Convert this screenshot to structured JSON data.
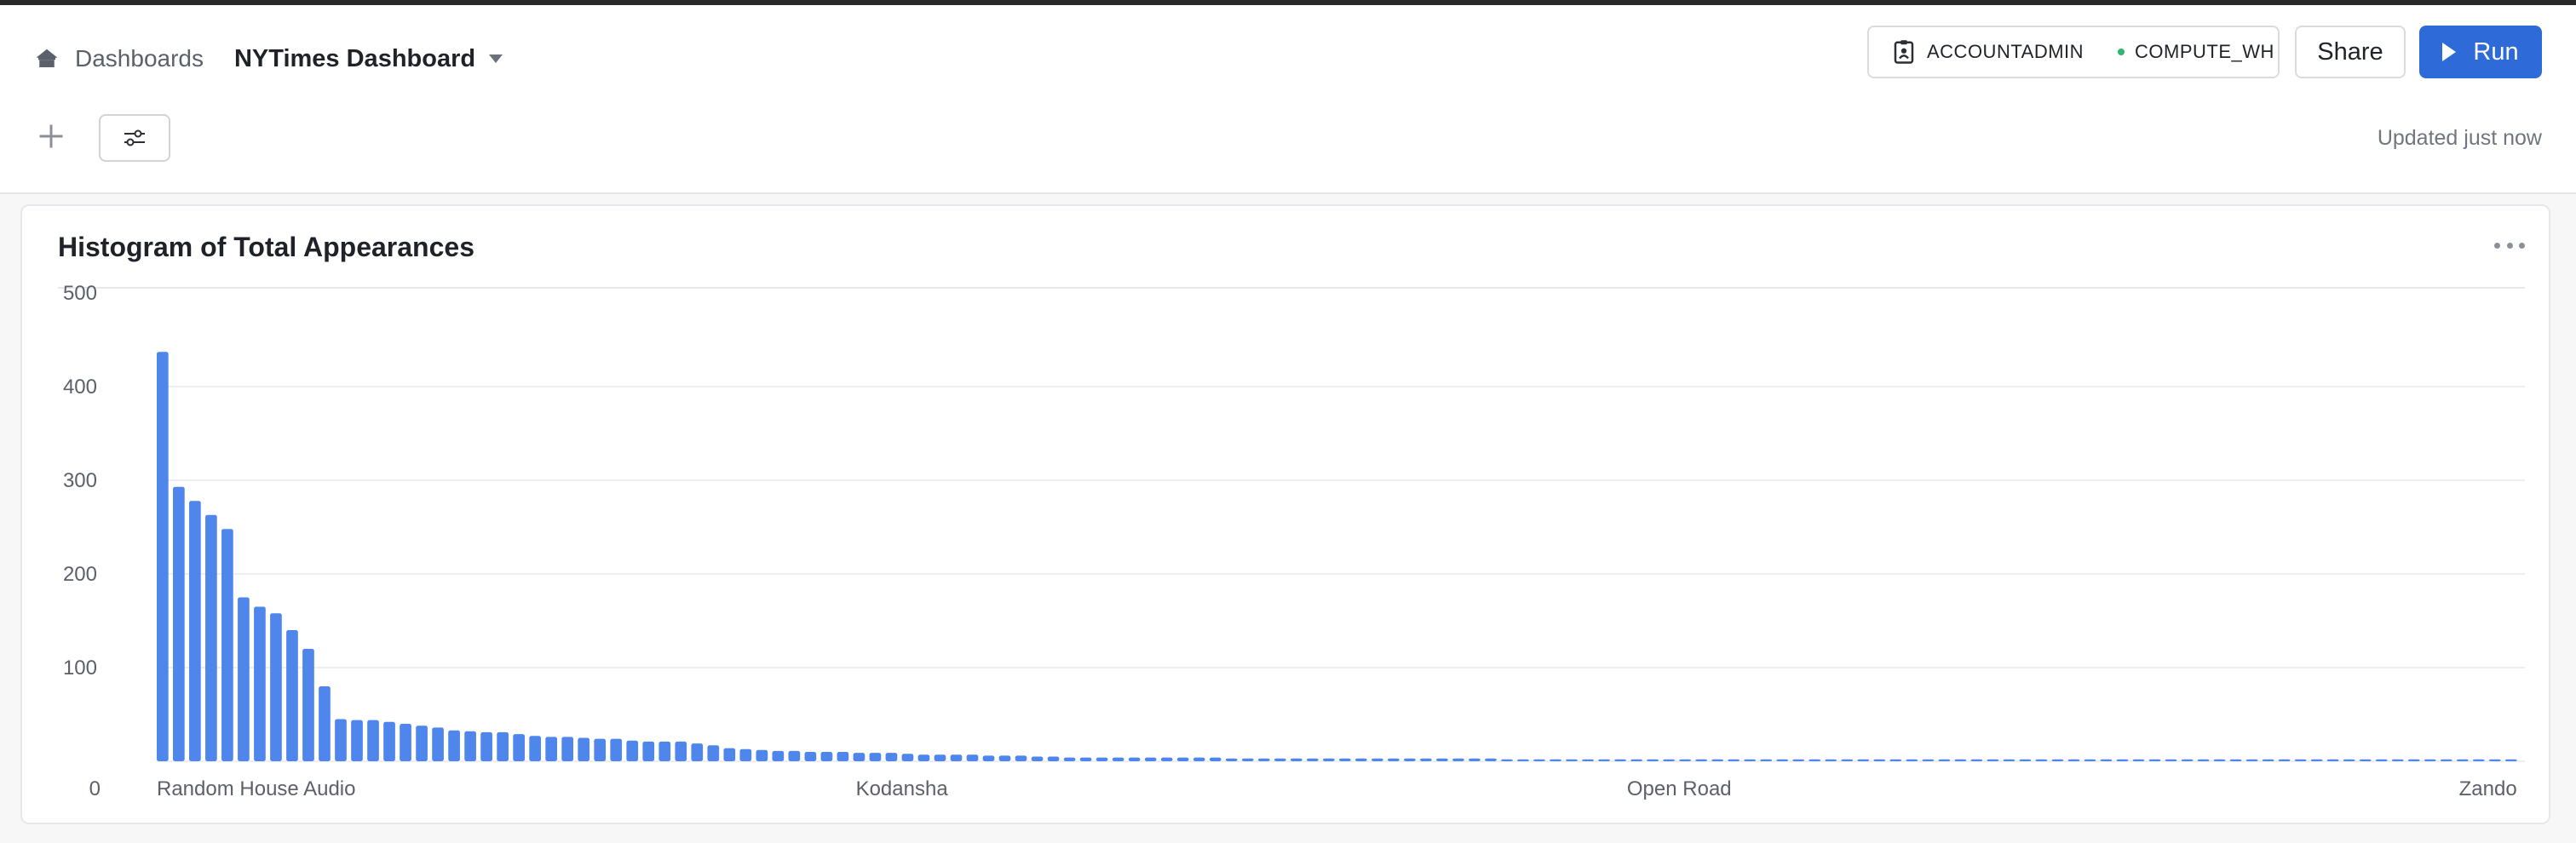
{
  "header": {
    "breadcrumb_label": "Dashboards",
    "dashboard_title": "NYTimes Dashboard",
    "role": "ACCOUNTADMIN",
    "warehouse": "COMPUTE_WH",
    "share_label": "Share",
    "run_label": "Run",
    "updated_text": "Updated just now"
  },
  "colors": {
    "accent": "#2f6ad9",
    "bar": "#4f86ec",
    "status_dot": "#2bb673"
  },
  "icons": [
    "home-icon",
    "badge-icon",
    "play-icon",
    "plus-icon",
    "filter-sliders-icon",
    "more-horizontal-icon"
  ],
  "card": {
    "title": "Histogram of Total Appearances"
  },
  "chart_data": {
    "type": "bar",
    "title": "Histogram of Total Appearances",
    "xlabel": "",
    "ylabel": "",
    "ylim": [
      0,
      500
    ],
    "yticks": [
      0,
      100,
      200,
      300,
      400,
      500
    ],
    "x_tick_labels": [
      "Random House Audio",
      "Kodansha",
      "Open Road",
      "Zando"
    ],
    "x_tick_indices": [
      0,
      46,
      94,
      145
    ],
    "grid": true,
    "legend": "none",
    "values": [
      437,
      293,
      278,
      263,
      248,
      175,
      165,
      158,
      140,
      120,
      80,
      45,
      44,
      44,
      42,
      40,
      38,
      36,
      33,
      32,
      31,
      31,
      29,
      27,
      26,
      26,
      25,
      24,
      24,
      22,
      21,
      21,
      21,
      19,
      17,
      14,
      13,
      12,
      11,
      11,
      10,
      10,
      10,
      9,
      9,
      9,
      8,
      7,
      7,
      7,
      7,
      6,
      6,
      6,
      5,
      5,
      4,
      4,
      4,
      4,
      4,
      4,
      4,
      4,
      4,
      4,
      3,
      3,
      3,
      3,
      3,
      3,
      3,
      3,
      3,
      3,
      3,
      3,
      3,
      3,
      3,
      3,
      3,
      2,
      2,
      2,
      2,
      2,
      2,
      2,
      2,
      2,
      2,
      2,
      2,
      2,
      2,
      2,
      2,
      2,
      2,
      2,
      2,
      2,
      2,
      2,
      2,
      2,
      2,
      2,
      2,
      2,
      2,
      2,
      2,
      2,
      2,
      2,
      2,
      2,
      2,
      2,
      2,
      2,
      2,
      2,
      2,
      2,
      2,
      2,
      2,
      2,
      2,
      2,
      2,
      2,
      2,
      2,
      2,
      2,
      2,
      2,
      2,
      2,
      2,
      2
    ]
  }
}
